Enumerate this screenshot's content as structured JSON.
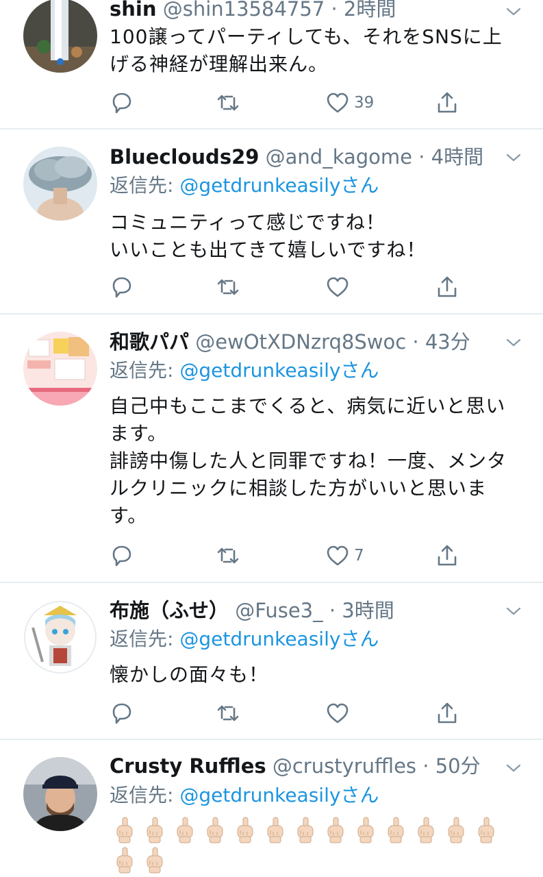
{
  "tweets": [
    {
      "name": "shin",
      "handle": "@shin13584757",
      "time": "2時間",
      "lines": [
        "100譲ってパーティしても、それをSNSに上",
        "げる神経が理解出来ん。"
      ],
      "like_count": "39",
      "avatar": "waterfall-avatar"
    },
    {
      "name": "Blueclouds29",
      "handle": "@and_kagome",
      "time": "4時間",
      "reply_label": "返信先: ",
      "reply_mention": "@getdrunkeasilyさん",
      "lines": [
        "コミュニティって感じですね！",
        "いいことも出てきて嬉しいですね！"
      ],
      "like_count": "",
      "avatar": "cloud-avatar"
    },
    {
      "name": "和歌パパ",
      "handle": "@ewOtXDNzrq8Swoc",
      "time": "43分",
      "reply_label": "返信先: ",
      "reply_mention": "@getdrunkeasilyさん",
      "lines": [
        "自己中もここまでくると、病気に近いと思い",
        "ます。",
        "誹謗中傷した人と同罪ですね！一度、メンタ",
        "ルクリニックに相談した方がいいと思いま",
        "す。"
      ],
      "like_count": "7",
      "avatar": "food-menu-avatar"
    },
    {
      "name": "布施（ふせ）",
      "handle": "@Fuse3_",
      "time": "3時間",
      "reply_label": "返信先: ",
      "reply_mention": "@getdrunkeasilyさん",
      "lines": [
        "懐かしの面々も！"
      ],
      "like_count": "",
      "avatar": "anime-character-avatar"
    },
    {
      "name": "Crusty Ruffles",
      "handle": "@crustyruffles",
      "time": "50分",
      "reply_label": "返信先: ",
      "reply_mention": "@getdrunkeasilyさん",
      "emoji": "middle-finger",
      "emoji_count_row1": 13,
      "emoji_count_row2": 2,
      "avatar": "man-in-cap-avatar"
    }
  ],
  "separator": " · ",
  "icons": [
    "reply-icon",
    "retweet-icon",
    "like-icon",
    "share-icon",
    "chevron-down-icon"
  ],
  "colors": {
    "link": "#1b95e0",
    "secondary": "#657786",
    "divider": "#e6ecf0"
  }
}
